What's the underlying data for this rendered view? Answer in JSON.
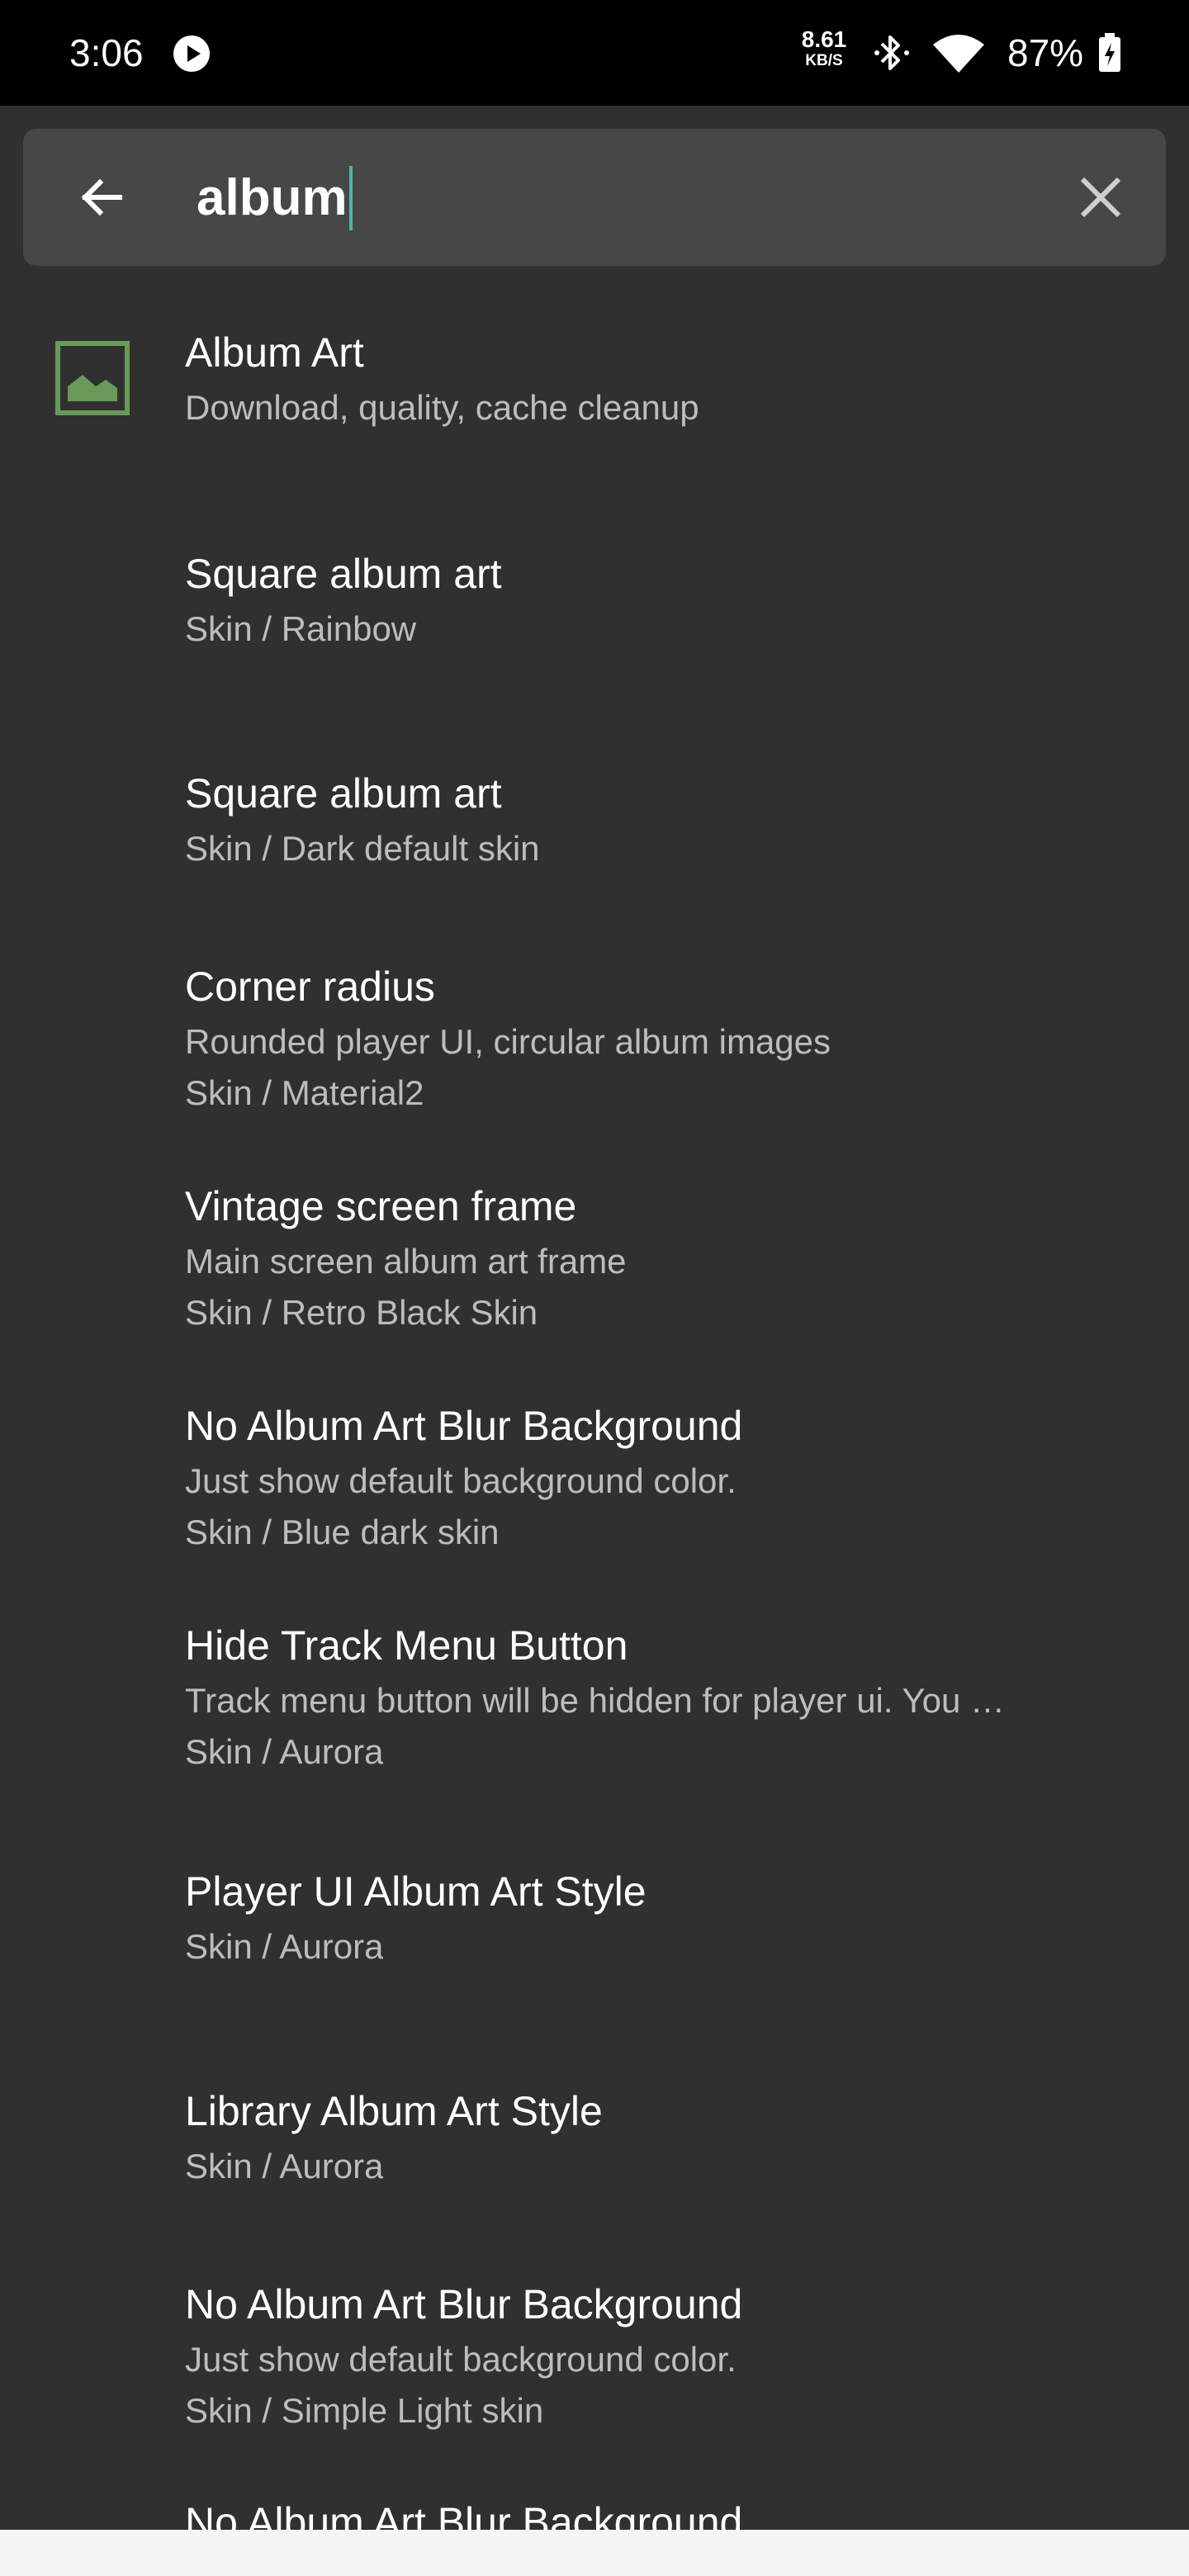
{
  "status_bar": {
    "time": "3:06",
    "net_speed_value": "8.61",
    "net_speed_unit": "KB/S",
    "battery": "87%",
    "icons": [
      "play-icon",
      "bluetooth-icon",
      "wifi-icon",
      "battery-icon"
    ]
  },
  "search": {
    "query": "album",
    "back_icon": "arrow-left-icon",
    "clear_icon": "close-icon"
  },
  "results": [
    {
      "title": "Album Art",
      "lines": [
        "Download, quality, cache cleanup"
      ],
      "icon": "image-icon"
    },
    {
      "title": "Square album art",
      "lines": [
        "Skin / Rainbow"
      ]
    },
    {
      "title": "Square album art",
      "lines": [
        "Skin / Dark default skin"
      ]
    },
    {
      "title": "Corner radius",
      "lines": [
        "Rounded player UI, circular album images",
        "Skin / Material2"
      ]
    },
    {
      "title": "Vintage screen frame",
      "lines": [
        "Main screen album art frame",
        "Skin / Retro Black Skin"
      ]
    },
    {
      "title": "No Album Art Blur Background",
      "lines": [
        "Just show default background color.",
        "Skin / Blue dark skin"
      ]
    },
    {
      "title": "Hide Track Menu Button",
      "lines": [
        "Track menu button will be hidden for player ui. You …",
        "Skin / Aurora"
      ]
    },
    {
      "title": "Player UI Album Art Style",
      "lines": [
        "Skin / Aurora"
      ]
    },
    {
      "title": "Library Album Art Style",
      "lines": [
        "Skin / Aurora"
      ]
    },
    {
      "title": "No Album Art Blur Background",
      "lines": [
        "Just show default background color.",
        "Skin / Simple Light skin"
      ]
    },
    {
      "title": "No Album Art Blur Background",
      "lines": []
    }
  ],
  "colors": {
    "background": "#303030",
    "search_bar": "#474747",
    "caret": "#4db6ac",
    "icon_green": "#6a9a5a",
    "secondary_text": "#bdbdbd"
  }
}
